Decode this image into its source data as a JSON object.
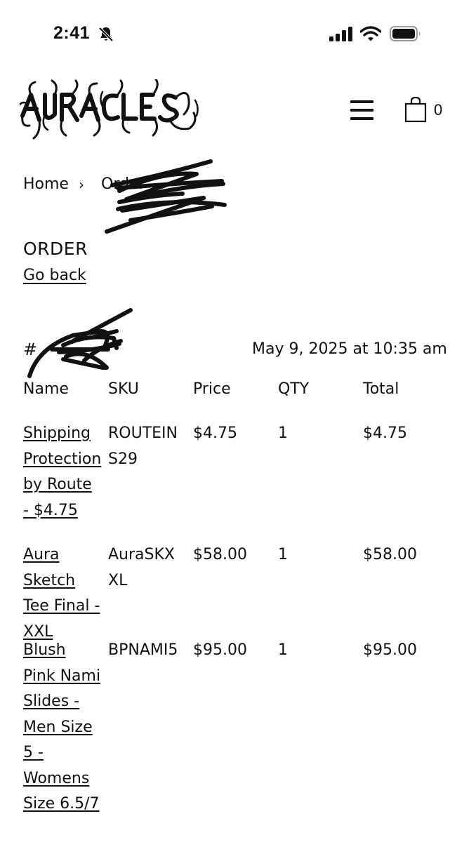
{
  "status_bar": {
    "time": "2:41"
  },
  "header": {
    "logo_text": "AURACLES",
    "cart_count": "0"
  },
  "breadcrumb": {
    "home": "Home",
    "separator": "›",
    "current": "Order"
  },
  "page": {
    "title": "ORDER",
    "back_link": "Go back"
  },
  "order": {
    "number": "#",
    "date": "May 9, 2025 at 10:35 am"
  },
  "table": {
    "headers": {
      "name": "Name",
      "sku": "SKU",
      "price": "Price",
      "qty": "QTY",
      "total": "Total"
    },
    "rows": [
      {
        "name": "Shipping Protection by Route - $4.75",
        "sku": "ROUTEINS29",
        "price": "$4.75",
        "qty": "1",
        "total": "$4.75"
      },
      {
        "name": "Aura Sketch Tee Final - XXL",
        "sku": "AuraSKXXL",
        "price": "$58.00",
        "qty": "1",
        "total": "$58.00"
      },
      {
        "name": "Blush Pink Nami Slides - Men Size 5 - Womens Size 6.5/7",
        "sku": "BPNAMI5",
        "price": "$95.00",
        "qty": "1",
        "total": "$95.00"
      }
    ]
  }
}
